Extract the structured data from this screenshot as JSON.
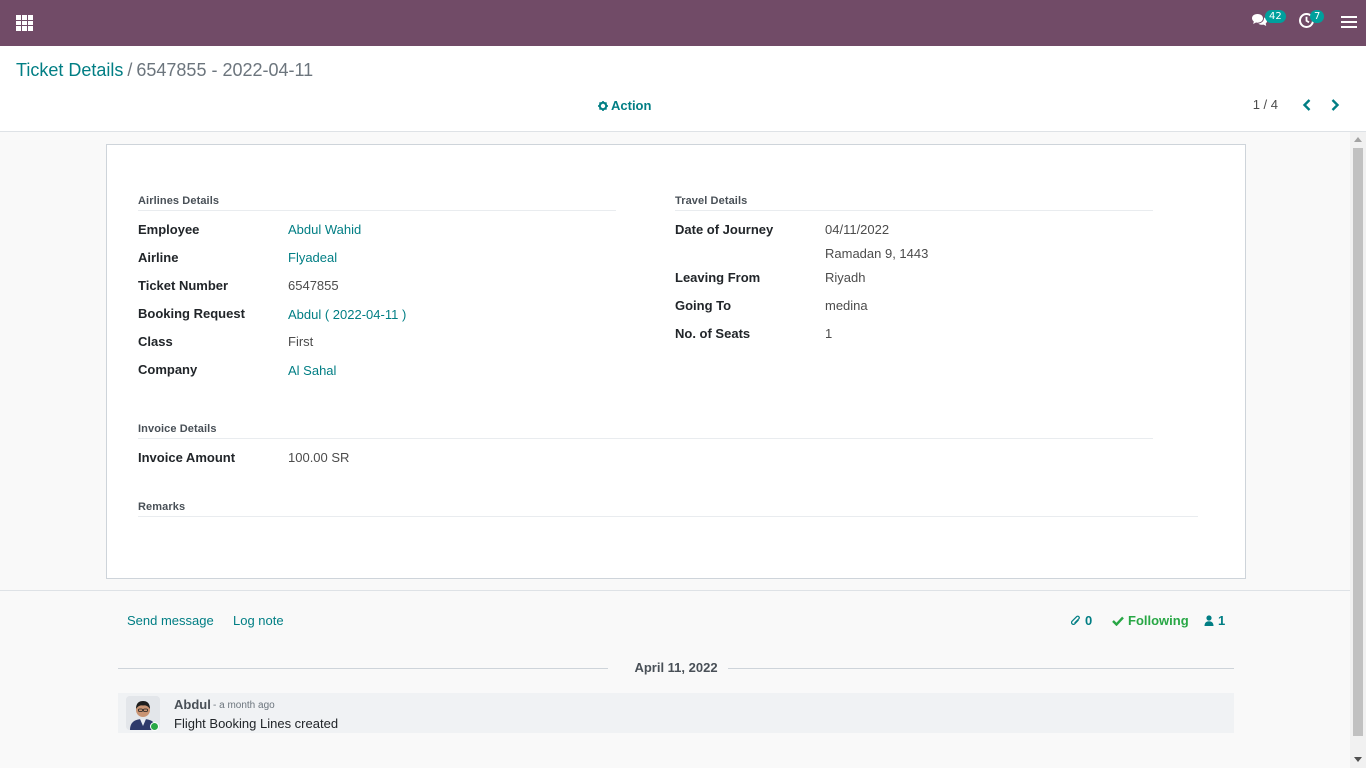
{
  "navbar": {
    "messages_count": "42",
    "activities_count": "7"
  },
  "breadcrumb": {
    "parent": "Ticket Details",
    "separator": "/",
    "current": "6547855 - 2022-04-11"
  },
  "control_panel": {
    "action_label": "Action",
    "pager": "1 / 4"
  },
  "airlines_details": {
    "title": "Airlines Details",
    "fields": {
      "employee": {
        "label": "Employee",
        "value": "Abdul Wahid"
      },
      "airline": {
        "label": "Airline",
        "value": "Flyadeal"
      },
      "ticket_number": {
        "label": "Ticket Number",
        "value": "6547855"
      },
      "booking_request": {
        "label": "Booking Request",
        "value": "Abdul ( 2022-04-11 )"
      },
      "class": {
        "label": "Class",
        "value": "First"
      },
      "company": {
        "label": "Company",
        "value": "Al Sahal"
      }
    }
  },
  "travel_details": {
    "title": "Travel Details",
    "fields": {
      "date_of_journey": {
        "label": "Date of Journey",
        "value": "04/11/2022",
        "hijri": "Ramadan 9, 1443"
      },
      "leaving_from": {
        "label": "Leaving From",
        "value": "Riyadh"
      },
      "going_to": {
        "label": "Going To",
        "value": "medina"
      },
      "no_of_seats": {
        "label": "No. of Seats",
        "value": "1"
      }
    }
  },
  "invoice_details": {
    "title": "Invoice Details",
    "invoice_amount": {
      "label": "Invoice Amount",
      "value": "100.00 SR"
    }
  },
  "remarks": {
    "title": "Remarks"
  },
  "chatter": {
    "send_message": "Send message",
    "log_note": "Log note",
    "attachments_count": "0",
    "following": "Following",
    "followers_count": "1",
    "date_separator": "April 11, 2022",
    "message": {
      "author": "Abdul",
      "date": "- a month ago",
      "body": "Flight Booking Lines created"
    }
  },
  "colors": {
    "navbar": "#714b67",
    "link": "#017e84",
    "badge": "#00a09d",
    "following": "#28a745"
  }
}
